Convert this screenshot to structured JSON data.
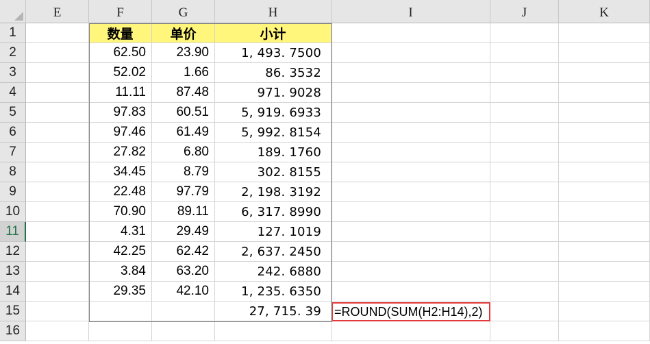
{
  "columns": [
    "E",
    "F",
    "G",
    "H",
    "I",
    "J",
    "K"
  ],
  "rows": [
    "1",
    "2",
    "3",
    "4",
    "5",
    "6",
    "7",
    "8",
    "9",
    "10",
    "11",
    "12",
    "13",
    "14",
    "15",
    "16"
  ],
  "selected_row": "11",
  "header": {
    "qty": "数量",
    "price": "单价",
    "subtotal": "小计"
  },
  "data": [
    {
      "qty": "62.50",
      "price": "23.90",
      "subtotal": "1, 493. 7500"
    },
    {
      "qty": "52.02",
      "price": "1.66",
      "subtotal": "86. 3532"
    },
    {
      "qty": "11.11",
      "price": "87.48",
      "subtotal": "971. 9028"
    },
    {
      "qty": "97.83",
      "price": "60.51",
      "subtotal": "5, 919. 6933"
    },
    {
      "qty": "97.46",
      "price": "61.49",
      "subtotal": "5, 992. 8154"
    },
    {
      "qty": "27.82",
      "price": "6.80",
      "subtotal": "189. 1760"
    },
    {
      "qty": "34.45",
      "price": "8.79",
      "subtotal": "302. 8155"
    },
    {
      "qty": "22.48",
      "price": "97.79",
      "subtotal": "2, 198. 3192"
    },
    {
      "qty": "70.90",
      "price": "89.11",
      "subtotal": "6, 317. 8990"
    },
    {
      "qty": "4.31",
      "price": "29.49",
      "subtotal": "127. 1019"
    },
    {
      "qty": "42.25",
      "price": "62.42",
      "subtotal": "2, 637. 2450"
    },
    {
      "qty": "3.84",
      "price": "63.20",
      "subtotal": "242. 6880"
    },
    {
      "qty": "29.35",
      "price": "42.10",
      "subtotal": "1, 235. 6350"
    }
  ],
  "total": "27, 715. 39",
  "formula": "=ROUND(SUM(H2:H14),2)",
  "colors": {
    "header_fill": "#fff67b",
    "formula_border": "#e23a3a",
    "selected_row_accent": "#217346"
  }
}
